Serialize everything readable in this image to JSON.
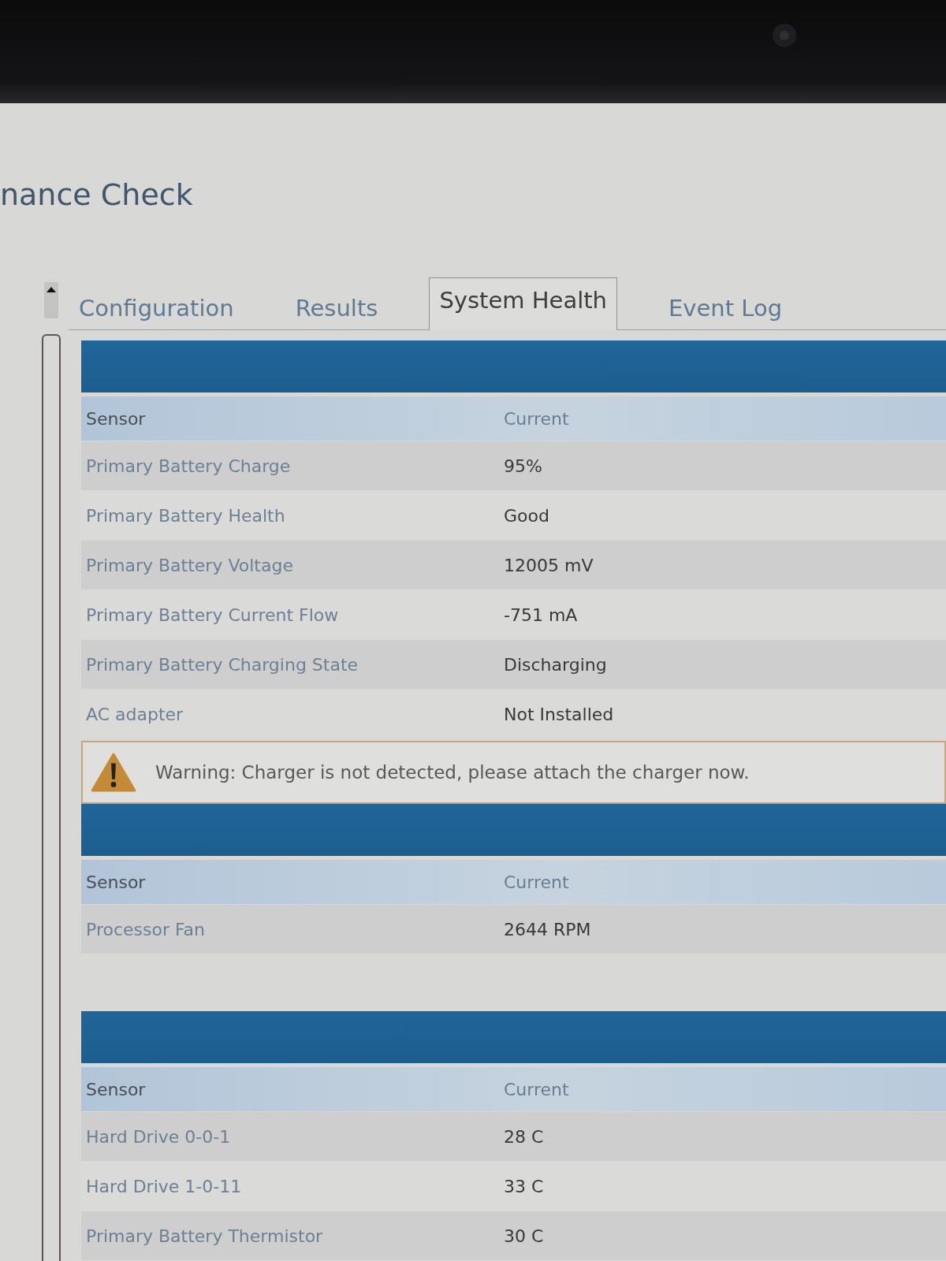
{
  "window": {
    "title": "nance Check"
  },
  "tabs": [
    {
      "label": "Configuration",
      "selected": false
    },
    {
      "label": "Results",
      "selected": false
    },
    {
      "label": "System Health",
      "selected": true
    },
    {
      "label": "Event Log",
      "selected": false
    }
  ],
  "sections": [
    {
      "kind": "table",
      "columns": [
        "Sensor",
        "Current"
      ],
      "rows": [
        {
          "sensor": "Primary Battery Charge",
          "current": "95%"
        },
        {
          "sensor": "Primary Battery Health",
          "current": "Good"
        },
        {
          "sensor": "Primary Battery Voltage",
          "current": "12005 mV"
        },
        {
          "sensor": "Primary Battery Current Flow",
          "current": "-751 mA"
        },
        {
          "sensor": "Primary Battery Charging State",
          "current": "Discharging"
        },
        {
          "sensor": "AC adapter",
          "current": "Not Installed"
        }
      ]
    },
    {
      "kind": "warning",
      "text": "Warning: Charger is not detected, please attach the charger now."
    },
    {
      "kind": "table",
      "columns": [
        "Sensor",
        "Current"
      ],
      "rows": [
        {
          "sensor": "Processor Fan",
          "current": "2644 RPM"
        }
      ]
    },
    {
      "kind": "table",
      "columns": [
        "Sensor",
        "Current"
      ],
      "rows": [
        {
          "sensor": "Hard Drive 0-0-1",
          "current": "28 C"
        },
        {
          "sensor": "Hard Drive 1-0-11",
          "current": "33 C"
        },
        {
          "sensor": "Primary Battery Thermistor",
          "current": "30 C"
        }
      ]
    }
  ]
}
